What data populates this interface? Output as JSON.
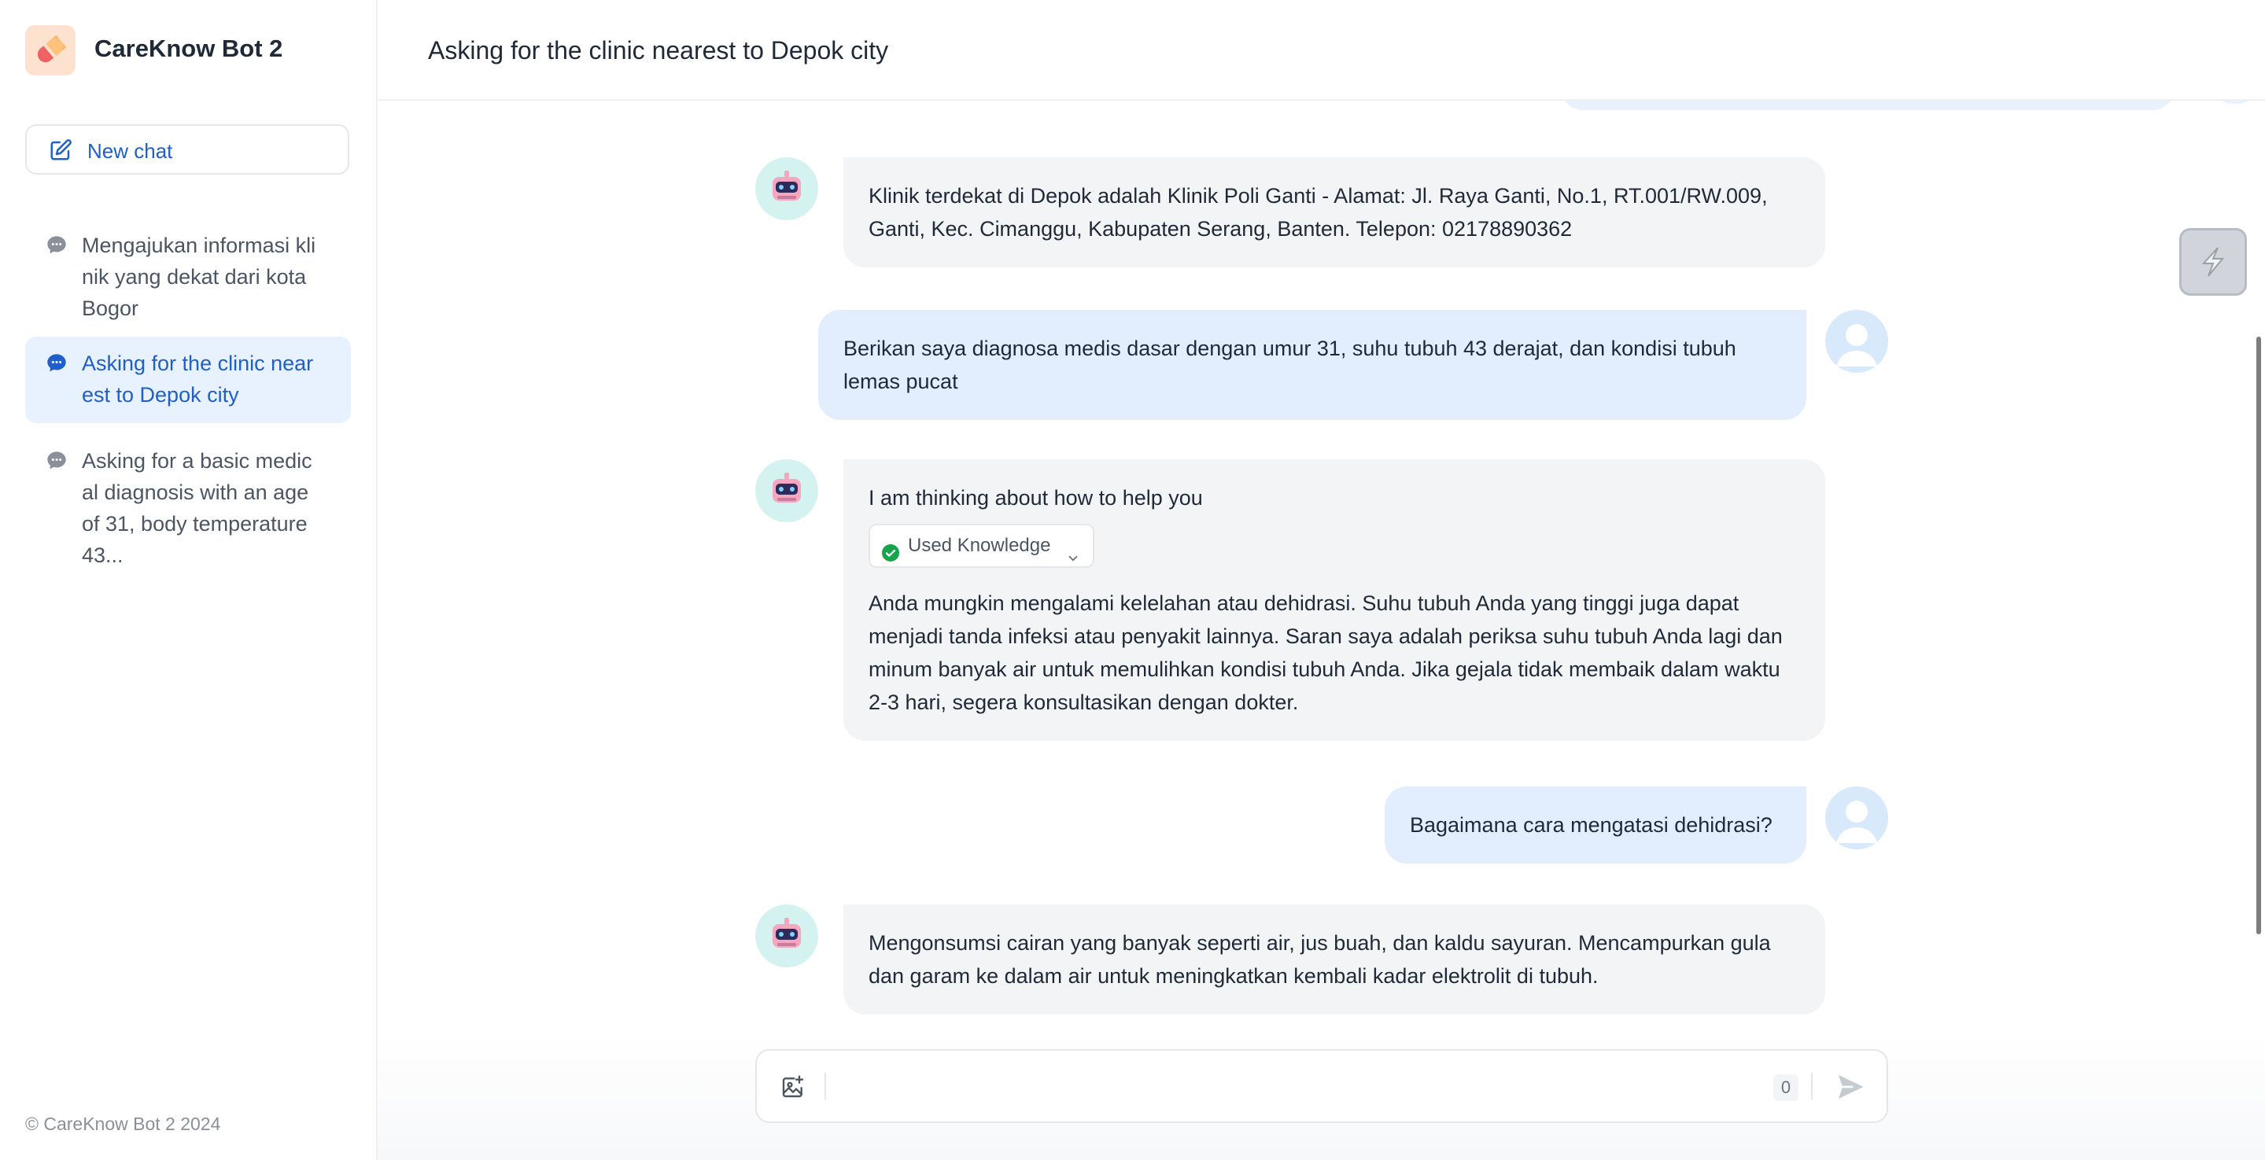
{
  "app": {
    "title": "CareKnow Bot 2",
    "new_chat_label": "New chat",
    "footer": "© CareKnow Bot 2 2024"
  },
  "sidebar": {
    "conversations": [
      {
        "title": "Mengajukan informasi klinik yang dekat dari kota Bogor",
        "active": false
      },
      {
        "title": "Asking for the clinic nearest to Depok city",
        "active": true
      },
      {
        "title": "Asking for a basic medical diagnosis with an age of 31, body temperature 43...",
        "active": false
      }
    ]
  },
  "header": {
    "title": "Asking for the clinic nearest to Depok city"
  },
  "messages": [
    {
      "role": "bot",
      "text": "Klinik terdekat di Depok adalah Klinik Poli Ganti - Alamat: Jl. Raya Ganti, No.1, RT.001/RW.009, Ganti, Kec. Cimanggu, Kabupaten Serang, Banten. Telepon: 02178890362"
    },
    {
      "role": "user",
      "text": "Berikan saya diagnosa medis dasar dengan umur 31, suhu tubuh 43 derajat, dan kondisi tubuh lemas pucat"
    },
    {
      "role": "bot",
      "thinking": "I am thinking about how to help you",
      "knowledge_label": "Used Knowledge",
      "text": "Anda mungkin mengalami kelelahan atau dehidrasi. Suhu tubuh Anda yang tinggi juga dapat menjadi tanda infeksi atau penyakit lainnya. Saran saya adalah periksa suhu tubuh Anda lagi dan minum banyak air untuk memulihkan kondisi tubuh Anda. Jika gejala tidak membaik dalam waktu 2-3 hari, segera konsultasikan dengan dokter."
    },
    {
      "role": "user",
      "text": "Bagaimana cara mengatasi dehidrasi?"
    },
    {
      "role": "bot",
      "text": "Mengonsumsi cairan yang banyak seperti air, jus buah, dan kaldu sayuran. Mencampurkan gula dan garam ke dalam air untuk meningkatkan kembali kadar elektrolit di tubuh."
    }
  ],
  "input": {
    "placeholder": "",
    "char_count": "0"
  },
  "colors": {
    "accent": "#1f5fc9",
    "active_bg": "#e8f1fe",
    "user_bubble": "#e2eefd",
    "bot_bubble": "#f3f4f6"
  },
  "icons": {
    "logo": "pill-icon",
    "new_chat": "edit-icon",
    "conversation": "chat-bubble-icon",
    "knowledge": "check-circle-icon",
    "image_upload": "image-plus-icon",
    "send": "send-icon"
  }
}
